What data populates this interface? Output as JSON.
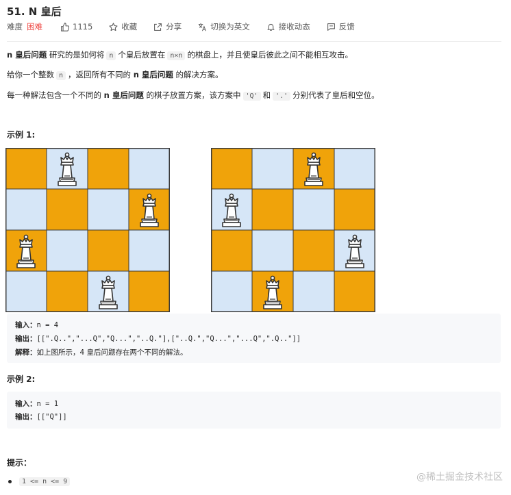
{
  "problem": {
    "title": "51. N 皇后",
    "difficulty_label": "难度",
    "difficulty": "困难",
    "likes": "1115",
    "favorite": "收藏",
    "share": "分享",
    "switch_lang": "切换为英文",
    "notify": "接收动态",
    "feedback": "反馈"
  },
  "description": {
    "p1_bold": "n 皇后问题",
    "p1_a": "研究的是如何将",
    "p1_code1": "n",
    "p1_b": "个皇后放置在",
    "p1_code2": "n×n",
    "p1_c": "的棋盘上，并且使皇后彼此之间不能相互攻击。",
    "p2_a": "给你一个整数",
    "p2_code": "n",
    "p2_b": "，返回所有不同的",
    "p2_bold": "n 皇后问题",
    "p2_c": "的解决方案。",
    "p3_a": "每一种解法包含一个不同的",
    "p3_bold": "n 皇后问题",
    "p3_b": "的棋子放置方案，该方案中",
    "p3_code1": "'Q'",
    "p3_c": "和",
    "p3_code2": "'.'",
    "p3_d": "分别代表了皇后和空位。"
  },
  "example1": {
    "title": "示例 1:",
    "boards": [
      {
        "queens": [
          1,
          3,
          0,
          2
        ]
      },
      {
        "queens": [
          2,
          0,
          3,
          1
        ]
      }
    ],
    "input_label": "输入：",
    "input": "n = 4",
    "output_label": "输出：",
    "output": "[[\".Q..\",\"...Q\",\"Q...\",\"..Q.\"],[\"..Q.\",\"Q...\",\"...Q\",\".Q..\"]]",
    "explain_label": "解释：",
    "explain": "如上图所示，4 皇后问题存在两个不同的解法。"
  },
  "example2": {
    "title": "示例 2:",
    "input_label": "输入：",
    "input": "n = 1",
    "output_label": "输出：",
    "output": "[[\"Q\"]]"
  },
  "hints": {
    "title": "提示：",
    "items": [
      "1 <= n <= 9"
    ]
  },
  "watermark": "@稀土掘金技术社区",
  "colors": {
    "difficulty": "#ef4743",
    "board_dark": "#f0a30a",
    "board_light": "#d6e6f7",
    "code_bg": "#f7f8fa"
  }
}
